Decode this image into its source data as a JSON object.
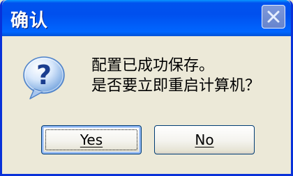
{
  "window": {
    "title": "确认",
    "close_icon": "close-icon",
    "title_color": "#0054e3"
  },
  "message": {
    "icon": "question-icon",
    "line1": "配置已成功保存。",
    "line2": "是否要立即重启计算机？"
  },
  "buttons": {
    "yes_label": "Yes",
    "no_label": "No"
  }
}
